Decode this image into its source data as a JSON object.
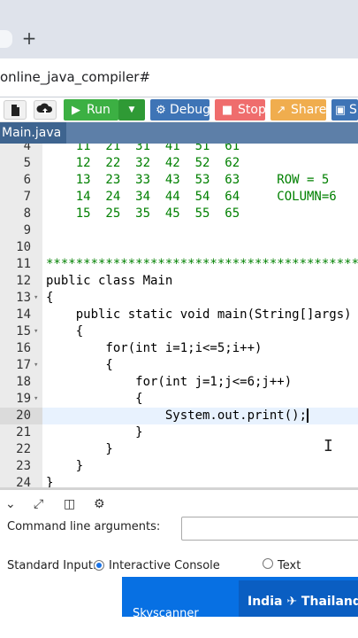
{
  "browser": {
    "new_tab_glyph": "+",
    "url": "online_java_compiler#"
  },
  "toolbar": {
    "run_label": "Run",
    "run_dropdown_glyph": "▼",
    "debug_label": "Debug",
    "stop_label": "Stop",
    "share_label": "Share",
    "save_label": "S",
    "colors": {
      "run": "#3cb043",
      "run_dark": "#2f9a35",
      "debug": "#3e74b6",
      "stop": "#ef6d6d",
      "share": "#f0ad4e",
      "save": "#3e74b6"
    }
  },
  "file_tab": {
    "label": "Main.java"
  },
  "editor": {
    "lines": [
      {
        "num": "4",
        "fold": "",
        "code": "    11  21  31  41  51  61",
        "cls": "g"
      },
      {
        "num": "5",
        "fold": "",
        "code": "    12  22  32  42  52  62",
        "cls": "g"
      },
      {
        "num": "6",
        "fold": "",
        "code": "    13  23  33  43  53  63     ROW = 5",
        "cls": "g"
      },
      {
        "num": "7",
        "fold": "",
        "code": "    14  24  34  44  54  64     COLUMN=6",
        "cls": "g"
      },
      {
        "num": "8",
        "fold": "",
        "code": "    15  25  35  45  55  65",
        "cls": "g"
      },
      {
        "num": "9",
        "fold": "",
        "code": "",
        "cls": "g"
      },
      {
        "num": "10",
        "fold": "",
        "code": "",
        "cls": "g"
      },
      {
        "num": "11",
        "fold": "",
        "code": "**************************************************",
        "cls": "g"
      },
      {
        "num": "12",
        "fold": "",
        "code": "public class Main",
        "cls": "p"
      },
      {
        "num": "13",
        "fold": "▾",
        "code": "{",
        "cls": "p"
      },
      {
        "num": "14",
        "fold": "",
        "code": "    public static void main(String[]args)",
        "cls": "p"
      },
      {
        "num": "15",
        "fold": "▾",
        "code": "    {",
        "cls": "p"
      },
      {
        "num": "16",
        "fold": "",
        "code": "        for(int i=1;i<=5;i++)",
        "cls": "p"
      },
      {
        "num": "17",
        "fold": "▾",
        "code": "        {",
        "cls": "p"
      },
      {
        "num": "18",
        "fold": "",
        "code": "            for(int j=1;j<=6;j++)",
        "cls": "p"
      },
      {
        "num": "19",
        "fold": "▾",
        "code": "            {",
        "cls": "p"
      },
      {
        "num": "20",
        "fold": "",
        "code": "                System.out.print();",
        "cls": "p"
      },
      {
        "num": "21",
        "fold": "",
        "code": "            }",
        "cls": "p"
      },
      {
        "num": "22",
        "fold": "",
        "code": "        }",
        "cls": "p"
      },
      {
        "num": "23",
        "fold": "",
        "code": "    }",
        "cls": "p"
      },
      {
        "num": "24",
        "fold": "",
        "code": "}",
        "cls": "p"
      }
    ],
    "active_line": "20"
  },
  "bottom_panel": {
    "command_line_label": "Command line arguments:",
    "command_line_value": "",
    "stdin_label": "Standard Input:",
    "interactive_label": "Interactive Console",
    "text_label": "Text",
    "selected_stdin": "interactive"
  },
  "ad": {
    "route": "India ✈ Thailand",
    "brand": "Skyscanner"
  },
  "icons": {
    "file": "file-icon",
    "upload": "upload-icon",
    "run": "play-icon",
    "debug": "debug-icon",
    "stop": "stop-icon",
    "share": "share-icon",
    "save": "save-icon",
    "collapse": "chevron-down-icon",
    "expand": "expand-icon",
    "layout": "layout-icon",
    "settings": "gear-icon"
  }
}
